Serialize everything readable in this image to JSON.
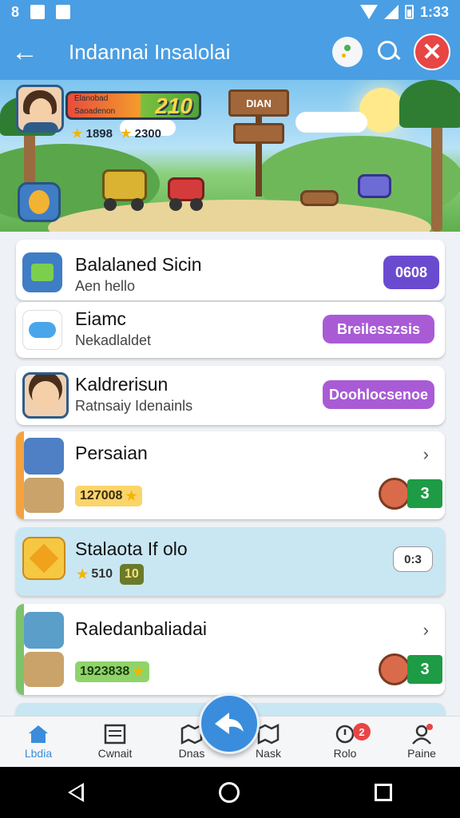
{
  "status_bar": {
    "left_text": "8",
    "time": "1:33"
  },
  "app_bar": {
    "title": "Indannai Insalolai"
  },
  "banner": {
    "player_name": "Elanobad",
    "player_sub": "Saoadenon",
    "level": "210",
    "stat1": "1898",
    "stat2": "2300",
    "sign_text": "DIAN"
  },
  "list": [
    {
      "title": "Balalaned Sicin",
      "subtitle": "Aen hello",
      "pill": "0608",
      "pill_color": "#6a4bd0"
    },
    {
      "title": "Eiamc",
      "subtitle": "Nekadlaldet",
      "pill": "Breilesszsis",
      "pill_color": "#a95bd6"
    },
    {
      "title": "Kaldrerisun",
      "subtitle": "Ratnsaiy Idenainls",
      "pill": "Doohlocsenoe",
      "pill_color": "#a95bd6"
    },
    {
      "title": "Persaian",
      "tag": "127008",
      "badge": "3"
    },
    {
      "title": "Stalaota If olo",
      "tag_prefix": "510",
      "tag": "10",
      "button": "0:3"
    },
    {
      "title": "Raledanbaliadai",
      "tag": "1923838",
      "badge": "3"
    }
  ],
  "nav": [
    {
      "label": "Lbdia",
      "icon": "home-icon"
    },
    {
      "label": "Cwnait",
      "icon": "inventory-icon"
    },
    {
      "label": "Dnas",
      "icon": "map-icon"
    },
    {
      "label": "Nask",
      "icon": "tasks-icon"
    },
    {
      "label": "Rolo",
      "icon": "alert-icon",
      "badge": "2"
    },
    {
      "label": "Paine",
      "icon": "profile-icon"
    }
  ],
  "colors": {
    "primary": "#4a9ee3",
    "accent": "#3a8ddc",
    "danger": "#e84545",
    "success": "#1e9b45"
  }
}
